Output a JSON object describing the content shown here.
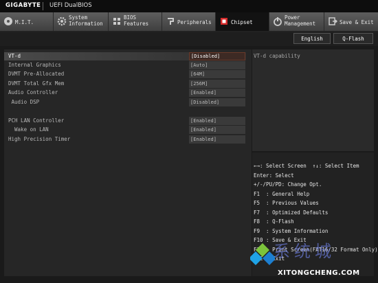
{
  "header": {
    "brand": "GIGABYTE",
    "product": "UEFI DualBIOS"
  },
  "tabs": [
    {
      "label": "M.I.T.",
      "icon": "disc-icon",
      "active": false
    },
    {
      "label": "System\nInformation",
      "icon": "gear-icon",
      "active": false
    },
    {
      "label": "BIOS\nFeatures",
      "icon": "bios-features-icon",
      "active": false
    },
    {
      "label": "Peripherals",
      "icon": "peripherals-icon",
      "active": false
    },
    {
      "label": "Chipset",
      "icon": "chipset-icon",
      "active": true
    },
    {
      "label": "Power\nManagement",
      "icon": "power-icon",
      "active": false
    },
    {
      "label": "Save & Exit",
      "icon": "exit-door-icon",
      "active": false
    }
  ],
  "toolbar": {
    "language": "English",
    "qflash": "Q-Flash"
  },
  "settings": [
    {
      "label": "VT-d",
      "value": "[Disabled]",
      "selected": true
    },
    {
      "label": "Internal Graphics",
      "value": "[Auto]",
      "selected": false
    },
    {
      "label": "DVMT Pre-Allocated",
      "value": "[64M]",
      "selected": false
    },
    {
      "label": "DVMT Total Gfx Mem",
      "value": "[256M]",
      "selected": false
    },
    {
      "label": "Audio Controller",
      "value": "[Enabled]",
      "selected": false
    },
    {
      "label": " Audio DSP",
      "value": "[Disabled]",
      "selected": false
    },
    {
      "label": "PCH LAN Controller",
      "value": "[Enabled]",
      "selected": false
    },
    {
      "label": "  Wake on LAN",
      "value": "[Enabled]",
      "selected": false
    },
    {
      "label": "High Precision Timer",
      "value": "[Enabled]",
      "selected": false
    }
  ],
  "help": {
    "text": "VT-d capability"
  },
  "keys": [
    "←→: Select Screen  ↑↓: Select Item",
    "Enter: Select",
    "+/-/PU/PD: Change Opt.",
    "F1  : General Help",
    "F5  : Previous Values",
    "F7  : Optimized Defaults",
    "F8  : Q-Flash",
    "F9  : System Information",
    "F10 : Save & Exit",
    "F12 : Print Screen(FAT16/32 Format Only)",
    "ESC : Exit"
  ],
  "watermark": {
    "cn": "系统城",
    "en": "XITONGCHENG.COM"
  },
  "colors": {
    "tab_active_bg": "#121212",
    "selected_value_border": "#6a3a2a",
    "panel_bg": "#262626"
  }
}
